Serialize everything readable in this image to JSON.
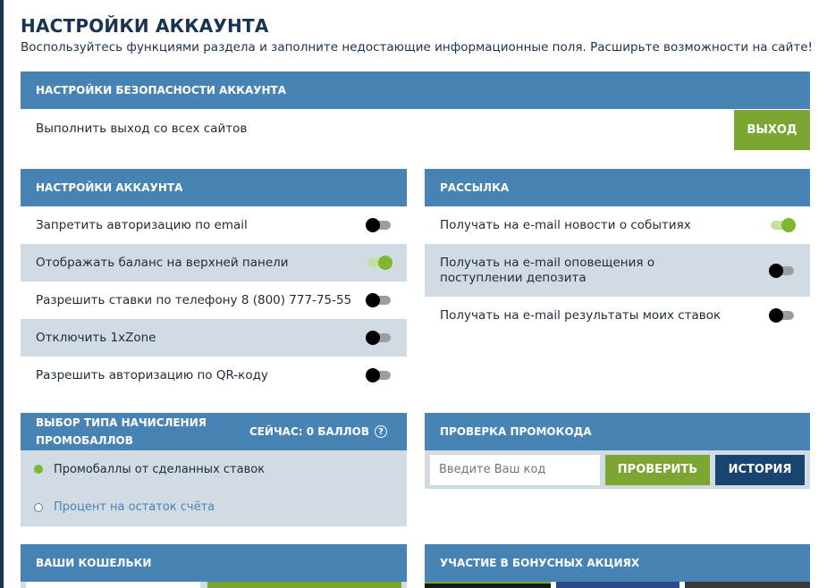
{
  "page": {
    "title": "НАСТРОЙКИ АККАУНТА",
    "subtitle": "Воспользуйтесь функциями раздела и заполните недостающие информационные поля. Расширьте возможности на сайте!"
  },
  "security": {
    "header": "НАСТРОЙКИ БЕЗОПАСНОСТИ АККАУНТА",
    "logout_text": "Выполнить выход со всех сайтов",
    "logout_button": "ВЫХОД"
  },
  "account_settings": {
    "header": "НАСТРОЙКИ АККАУНТА",
    "items": [
      {
        "label": "Запретить авторизацию по email",
        "enabled": false
      },
      {
        "label": "Отображать баланс на верхней панели",
        "enabled": true
      },
      {
        "label": "Разрешить ставки по телефону 8 (800) 777-75-55",
        "enabled": false
      },
      {
        "label": "Отключить 1xZone",
        "enabled": false
      },
      {
        "label": "Разрешить авторизацию по QR-коду",
        "enabled": false
      }
    ]
  },
  "mailing": {
    "header": "РАССЫЛКА",
    "items": [
      {
        "label": "Получать на e-mail новости о событиях",
        "enabled": true
      },
      {
        "label": "Получать на e-mail оповещения о поступлении депозита",
        "enabled": false
      },
      {
        "label": "Получать на e-mail результаты моих ставок",
        "enabled": false
      }
    ]
  },
  "promo_points": {
    "header": "ВЫБОР ТИПА НАЧИСЛЕНИЯ ПРОМОБАЛЛОВ",
    "current": "СЕЙЧАС: 0 БАЛЛОВ",
    "help_glyph": "?",
    "options": [
      {
        "label": "Промобаллы от сделанных ставок",
        "selected": true
      },
      {
        "label": "Процент на остаток счёта",
        "selected": false
      }
    ]
  },
  "promo_code": {
    "header": "ПРОВЕРКА ПРОМОКОДА",
    "placeholder": "Введите Ваш код",
    "check_button": "ПРОВЕРИТЬ",
    "history_button": "ИСТОРИЯ"
  },
  "wallets": {
    "header": "ВАШИ КОШЕЛЬКИ"
  },
  "bonus": {
    "header": "УЧАСТИЕ В БОНУСНЫХ АКЦИЯХ"
  },
  "colors": {
    "header_blue": "#4783b4",
    "navy": "#1a3350",
    "green": "#7ca531",
    "row_shade": "#d1dbe4"
  }
}
